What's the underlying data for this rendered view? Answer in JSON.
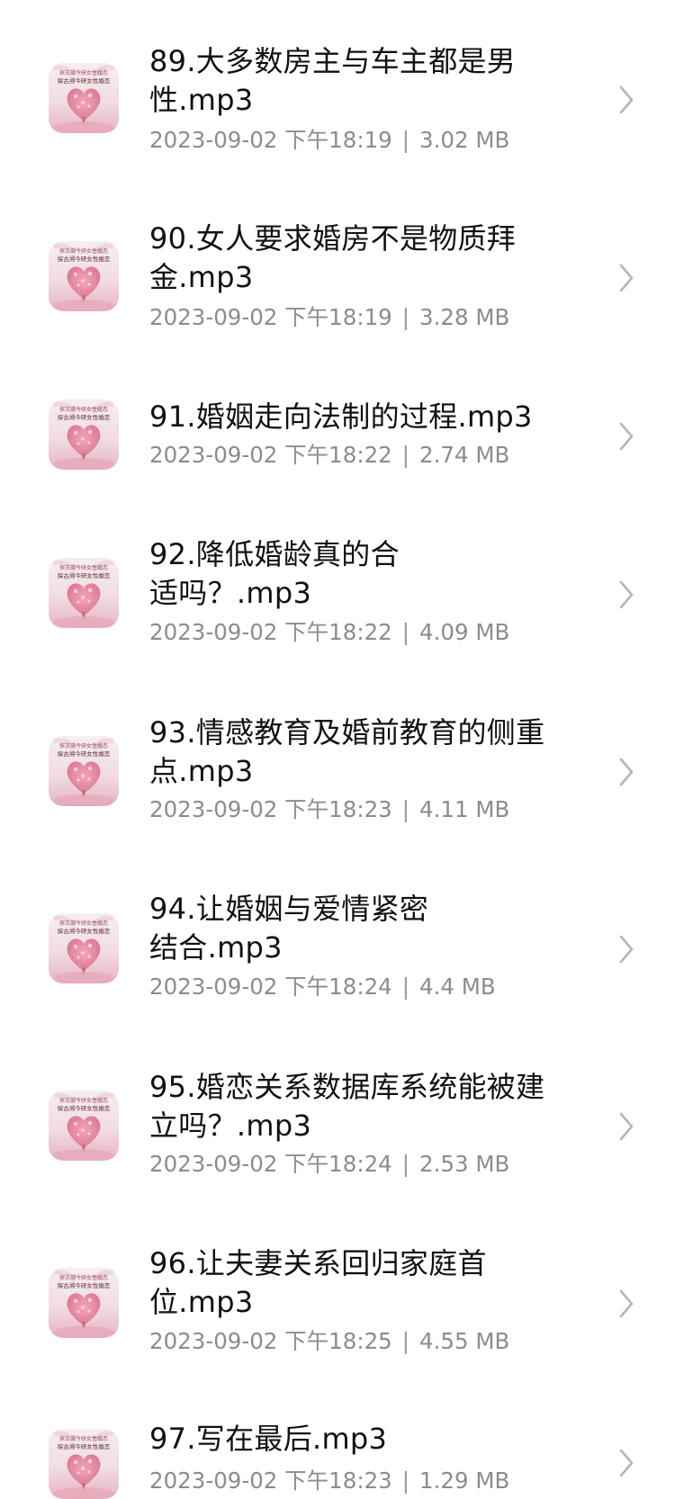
{
  "files": [
    {
      "title": "89.大多数房主与车主都是男性.mp3",
      "datetime": "2023-09-02 下午18:19",
      "size": "3.02 MB"
    },
    {
      "title": "90.女人要求婚房不是物质拜金.mp3",
      "datetime": "2023-09-02 下午18:19",
      "size": "3.28 MB"
    },
    {
      "title": "91.婚姻走向法制的过程.mp3",
      "datetime": "2023-09-02 下午18:22",
      "size": "2.74 MB"
    },
    {
      "title": "92.降低婚龄真的合适吗？.mp3",
      "datetime": "2023-09-02 下午18:22",
      "size": "4.09 MB"
    },
    {
      "title": "93.情感教育及婚前教育的侧重点.mp3",
      "datetime": "2023-09-02 下午18:23",
      "size": "4.11 MB"
    },
    {
      "title": "94.让婚姻与爱情紧密结合.mp3",
      "datetime": "2023-09-02 下午18:24",
      "size": "4.4 MB"
    },
    {
      "title": "95.婚恋关系数据库系统能被建立吗？.mp3",
      "datetime": "2023-09-02 下午18:24",
      "size": "2.53 MB"
    },
    {
      "title": "96.让夫妻关系回归家庭首位.mp3",
      "datetime": "2023-09-02 下午18:25",
      "size": "4.55 MB"
    },
    {
      "title": "97.写在最后.mp3",
      "datetime": "2023-09-02 下午18:23",
      "size": "1.29 MB"
    }
  ],
  "meta_separator": "|",
  "thumbnail": {
    "icon": "heart-tree-cover-icon",
    "caption": "探古溯今研女性婚恋"
  },
  "colors": {
    "title": "#111111",
    "meta": "#8c8c8c",
    "chevron": "#b5b5b5",
    "background": "#ffffff"
  }
}
